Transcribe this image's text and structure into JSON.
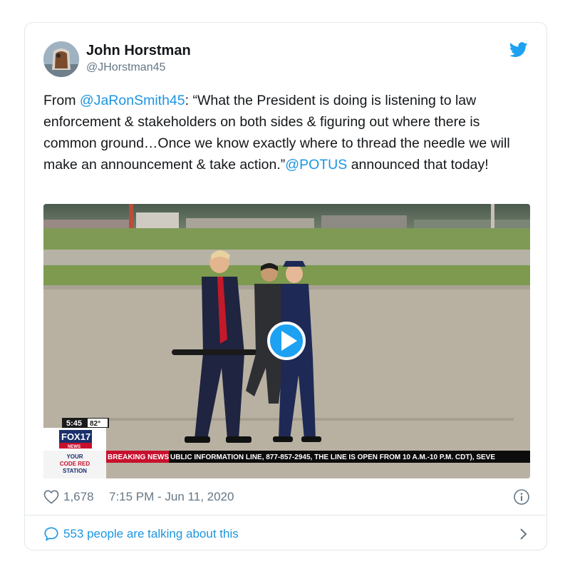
{
  "tweet": {
    "author_name": "John Horstman",
    "author_handle": "@JHorstman45",
    "text": {
      "t1": "From ",
      "mention1": "@JaRonSmith45",
      "t2": ": “What the President is doing is listening to law enforcement & stakeholders on both sides & figuring out where there is common ground…Once we know exactly where to thread the needle we will make an announcement & take action.”",
      "mention2": "@POTUS",
      "t3": " announced that today!"
    },
    "likes": "1,678",
    "timestamp": "7:15 PM - Jun 11, 2020",
    "talking": "553 people are talking about this"
  },
  "video": {
    "time": "5:45",
    "temp": "82°",
    "logo_main": "FOX17",
    "logo_sub": "NEWS",
    "station_line1": "YOUR",
    "station_line2": "CODE RED",
    "station_line3": "STATION",
    "breaking_label": "BREAKING NEWS",
    "ticker": "UBLIC INFORMATION LINE, 877-857-2945, THE LINE IS OPEN FROM 10 A.M.-10 P.M. CDT), SEVE"
  },
  "colors": {
    "link": "#1b95e0",
    "twitter_blue": "#1da1f2",
    "meta_gray": "#657786",
    "breaking_red": "#c8102e"
  },
  "icons": [
    "twitter-bird-icon",
    "heart-icon",
    "info-icon",
    "speech-bubble-icon",
    "chevron-right-icon",
    "play-icon"
  ]
}
